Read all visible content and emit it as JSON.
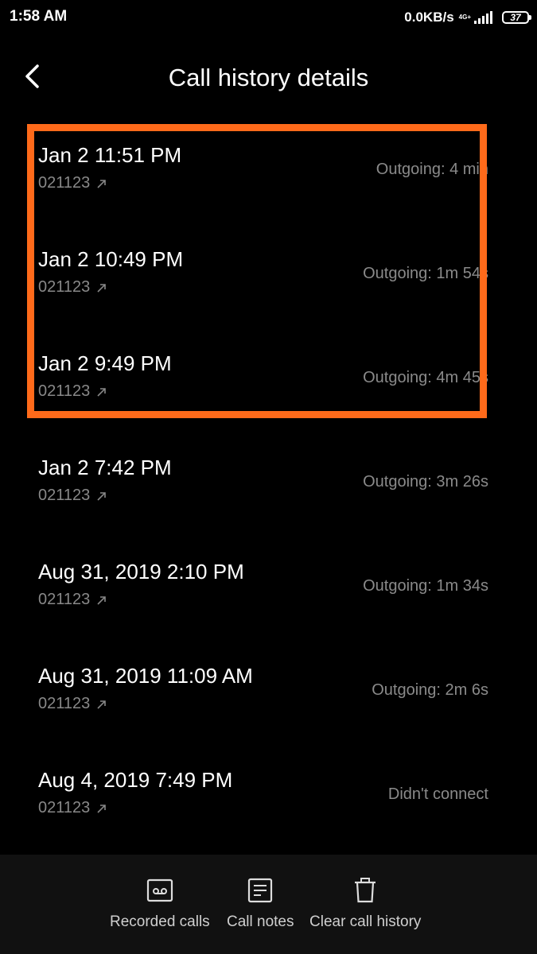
{
  "status_bar": {
    "time": "1:58 AM",
    "net_speed": "0.0KB/s",
    "net_type": "4G+",
    "battery_level": "37"
  },
  "header": {
    "title": "Call history details",
    "back_icon": "chevron-left-icon"
  },
  "calls": [
    {
      "datetime": "Jan 2 11:51 PM",
      "number": "021123",
      "status": "Outgoing: 4 min"
    },
    {
      "datetime": "Jan 2 10:49 PM",
      "number": "021123",
      "status": "Outgoing: 1m 54s"
    },
    {
      "datetime": "Jan 2 9:49 PM",
      "number": "021123",
      "status": "Outgoing: 4m 45s"
    },
    {
      "datetime": "Jan 2 7:42 PM",
      "number": "021123",
      "status": "Outgoing: 3m 26s"
    },
    {
      "datetime": "Aug 31, 2019 2:10 PM",
      "number": "021123",
      "status": "Outgoing: 1m 34s"
    },
    {
      "datetime": "Aug 31, 2019 11:09 AM",
      "number": "021123",
      "status": "Outgoing: 2m 6s"
    },
    {
      "datetime": "Aug 4, 2019 7:49 PM",
      "number": "021123",
      "status": "Didn't connect"
    }
  ],
  "bottom_bar": {
    "recorded_calls": "Recorded calls",
    "call_notes": "Call notes",
    "clear_call_history": "Clear call history"
  },
  "colors": {
    "background": "#000000",
    "highlight": "#ff6a1a",
    "secondary_text": "#888888",
    "bottom_bar": "#111111"
  }
}
